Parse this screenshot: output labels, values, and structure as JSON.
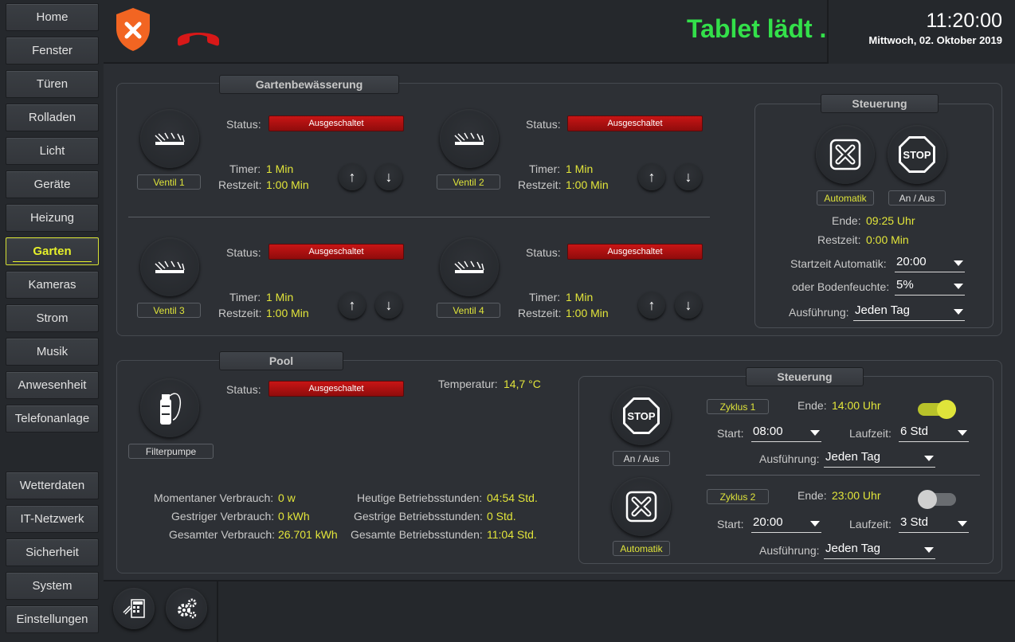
{
  "sidebar": {
    "items": [
      {
        "label": "Home"
      },
      {
        "label": "Fenster"
      },
      {
        "label": "Türen"
      },
      {
        "label": "Rolladen"
      },
      {
        "label": "Licht"
      },
      {
        "label": "Geräte"
      },
      {
        "label": "Heizung"
      },
      {
        "label": "Garten"
      },
      {
        "label": "Kameras"
      },
      {
        "label": "Strom"
      },
      {
        "label": "Musik"
      },
      {
        "label": "Anwesenheit"
      },
      {
        "label": "Telefonanlage"
      }
    ],
    "bottom_items": [
      {
        "label": "Wetterdaten"
      },
      {
        "label": "IT-Netzwerk"
      },
      {
        "label": "Sicherheit"
      },
      {
        "label": "System"
      },
      {
        "label": "Einstellungen"
      }
    ],
    "active": "Garten"
  },
  "header": {
    "charging_text": "Tablet lädt ...",
    "time": "11:20:00",
    "date": "Mittwoch, 02. Oktober 2019",
    "colors": {
      "charging": "#33e04a",
      "alarm": "#f26522",
      "phone": "#d81818"
    }
  },
  "garden": {
    "title": "Gartenbewässerung",
    "status_label": "Status:",
    "timer_label": "Timer:",
    "rest_label": "Restzeit:",
    "valves": [
      {
        "name": "Ventil 1",
        "status": "Ausgeschaltet",
        "timer": "1 Min",
        "rest": "1:00 Min"
      },
      {
        "name": "Ventil 2",
        "status": "Ausgeschaltet",
        "timer": "1 Min",
        "rest": "1:00 Min"
      },
      {
        "name": "Ventil 3",
        "status": "Ausgeschaltet",
        "timer": "1 Min",
        "rest": "1:00 Min"
      },
      {
        "name": "Ventil 4",
        "status": "Ausgeschaltet",
        "timer": "1 Min",
        "rest": "1:00 Min"
      }
    ],
    "up_glyph": "↑",
    "down_glyph": "↓",
    "control": {
      "title": "Steuerung",
      "automatik_label": "Automatik",
      "onoff_label": "An / Aus",
      "stop_text": "STOP",
      "end_label": "Ende:",
      "end_value": "09:25 Uhr",
      "rest_label": "Restzeit:",
      "rest_value": "0:00 Min",
      "start_label": "Startzeit Automatik:",
      "start_value": "20:00",
      "moisture_label": "oder Bodenfeuchte:",
      "moisture_value": "5%",
      "exec_label": "Ausführung:",
      "exec_value": "Jeden Tag"
    }
  },
  "pool": {
    "title": "Pool",
    "pump_label": "Filterpumpe",
    "status_label": "Status:",
    "status": "Ausgeschaltet",
    "temp_label": "Temperatur:",
    "temp_value": "14,7 °C",
    "stats_left": [
      {
        "label": "Momentaner Verbrauch:",
        "value": "0 w"
      },
      {
        "label": "Gestriger Verbrauch:",
        "value": "0 kWh"
      },
      {
        "label": "Gesamter Verbrauch:",
        "value": "26.701 kWh"
      }
    ],
    "stats_right": [
      {
        "label": "Heutige Betriebsstunden:",
        "value": "04:54 Std."
      },
      {
        "label": "Gestrige Betriebsstunden:",
        "value": "0 Std."
      },
      {
        "label": "Gesamte Betriebsstunden:",
        "value": "11:04 Std."
      }
    ],
    "control": {
      "title": "Steuerung",
      "stop_text": "STOP",
      "onoff_label": "An / Aus",
      "automatik_label": "Automatik",
      "cycles": [
        {
          "name": "Zyklus 1",
          "end_label": "Ende:",
          "end": "14:00 Uhr",
          "start_label": "Start:",
          "start": "08:00",
          "run_label": "Laufzeit:",
          "run": "6 Std",
          "exec_label": "Ausführung:",
          "exec": "Jeden Tag",
          "enabled": true
        },
        {
          "name": "Zyklus 2",
          "end_label": "Ende:",
          "end": "23:00 Uhr",
          "start_label": "Start:",
          "start": "20:00",
          "run_label": "Laufzeit:",
          "run": "3 Std",
          "exec_label": "Ausführung:",
          "exec": "Jeden Tag",
          "enabled": false
        }
      ]
    }
  }
}
